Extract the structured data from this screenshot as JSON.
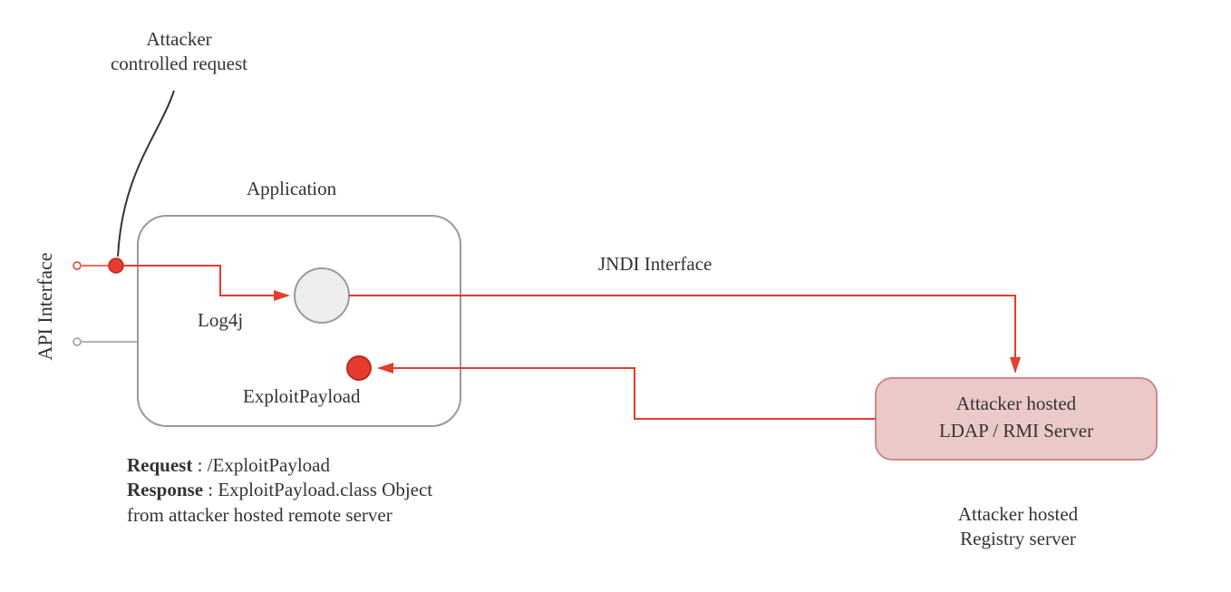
{
  "annotation": {
    "attacker_request": "Attacker\ncontrolled request"
  },
  "api_interface_label": "API Interface",
  "application": {
    "title": "Application",
    "log4j_label": "Log4j",
    "payload_label": "ExploitPayload"
  },
  "jndi_label": "JNDI Interface",
  "server_box": {
    "line1": "Attacker hosted",
    "line2": "LDAP / RMI Server"
  },
  "server_caption": "Attacker hosted\nRegistry server",
  "footer": {
    "request_label": "Request",
    "request_value": ": /ExploitPayload",
    "response_label": "Response",
    "response_value": ": ExploitPayload.class Object\nfrom attacker hosted remote server"
  },
  "colors": {
    "red": "#e63b2e",
    "gray_border": "#999999",
    "light_gray_fill": "#eeeeee",
    "pink_fill": "#ecc9c9",
    "pink_stroke": "#c98b8b",
    "black": "#333333"
  }
}
